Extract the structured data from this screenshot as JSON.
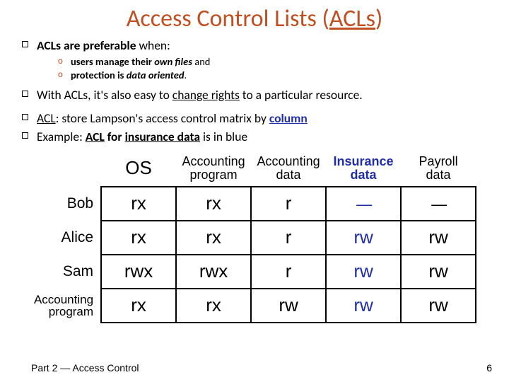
{
  "title": {
    "pre": "Access Control Lists (",
    "abbr": "ACLs",
    "post": ")"
  },
  "bullets": {
    "b1_pre": "ACLs are preferable",
    "b1_post": " when:",
    "s1_pre": "users manage their ",
    "s1_em": "own files",
    "s1_post": " and",
    "s2_pre": "protection is ",
    "s2_em": "data oriented",
    "s2_post": ".",
    "b2_pre": "With ACLs, it's also easy to ",
    "b2_u": "change rights",
    "b2_post": " to a particular resource.",
    "b3_pre": "ACL",
    "b3_mid": ": store Lampson's access control matrix by ",
    "b3_col": "column",
    "b4_pre": "Example: ",
    "b4_acl": "ACL",
    "b4_mid": " for ",
    "b4_ins": "insurance data",
    "b4_post": " is in blue"
  },
  "table": {
    "cols": {
      "c1": "OS",
      "c2a": "Accounting",
      "c2b": "program",
      "c3a": "Accounting",
      "c3b": "data",
      "c4a": "Insurance",
      "c4b": "data",
      "c5a": "Payroll",
      "c5b": "data"
    },
    "rows": {
      "r1": "Bob",
      "r2": "Alice",
      "r3": "Sam",
      "r4a": "Accounting",
      "r4b": "program"
    },
    "cells": {
      "r1c1": "rx",
      "r1c2": "rx",
      "r1c3": "r",
      "r1c4": "—",
      "r1c5": "—",
      "r2c1": "rx",
      "r2c2": "rx",
      "r2c3": "r",
      "r2c4": "rw",
      "r2c5": "rw",
      "r3c1": "rwx",
      "r3c2": "rwx",
      "r3c3": "r",
      "r3c4": "rw",
      "r3c5": "rw",
      "r4c1": "rx",
      "r4c2": "rx",
      "r4c3": "rw",
      "r4c4": "rw",
      "r4c5": "rw"
    }
  },
  "footer": "Part 2 — Access Control",
  "page": "6"
}
